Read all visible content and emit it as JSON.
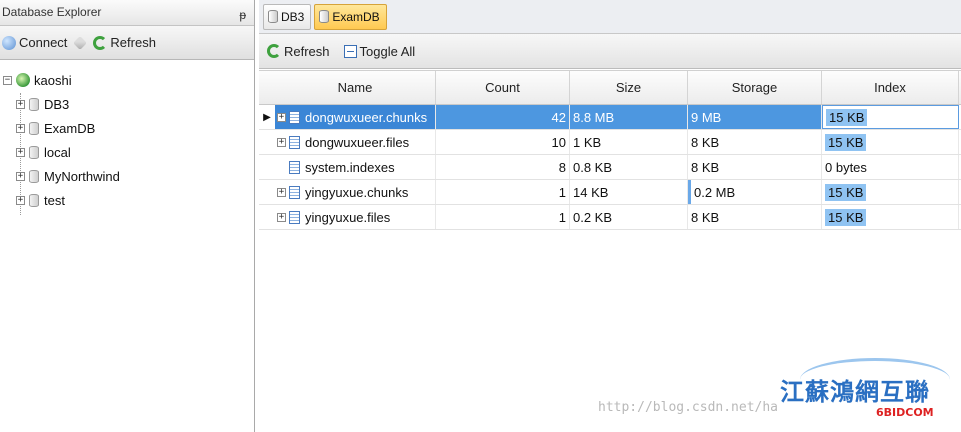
{
  "explorer": {
    "title": "Database Explorer",
    "pin": "ᵽ",
    "toolbar": {
      "connect_label": "Connect",
      "refresh_label": "Refresh"
    },
    "server": "kaoshi",
    "databases": [
      "DB3",
      "ExamDB",
      "local",
      "MyNorthwind",
      "test"
    ]
  },
  "tabs": [
    {
      "label": "DB3",
      "active": false
    },
    {
      "label": "ExamDB",
      "active": true
    }
  ],
  "doc_toolbar": {
    "refresh_label": "Refresh",
    "toggle_label": "Toggle All"
  },
  "grid": {
    "columns": [
      "Name",
      "Count",
      "Size",
      "Storage",
      "Index"
    ],
    "rows": [
      {
        "name": "dongwuxueer.chunks",
        "count": "42",
        "size": "8.8 MB",
        "storage": "9 MB",
        "index": "15 KB",
        "expandable": true,
        "selected": true
      },
      {
        "name": "dongwuxueer.files",
        "count": "10",
        "size": "1 KB",
        "storage": "8 KB",
        "index": "15 KB",
        "expandable": true,
        "selected": false
      },
      {
        "name": "system.indexes",
        "count": "8",
        "size": "0.8 KB",
        "storage": "8 KB",
        "index": "0 bytes",
        "expandable": false,
        "selected": false
      },
      {
        "name": "yingyuxue.chunks",
        "count": "1",
        "size": "14 KB",
        "storage": "0.2 MB",
        "index": "15 KB",
        "expandable": true,
        "selected": false
      },
      {
        "name": "yingyuxue.files",
        "count": "1",
        "size": "0.2 KB",
        "storage": "8 KB",
        "index": "15 KB",
        "expandable": true,
        "selected": false
      }
    ]
  },
  "watermark": {
    "url_text": "http://blog.csdn.net/ha",
    "logo_text": "江蘇鴻網互聯",
    "logo_sub": "6BIDCOM"
  }
}
